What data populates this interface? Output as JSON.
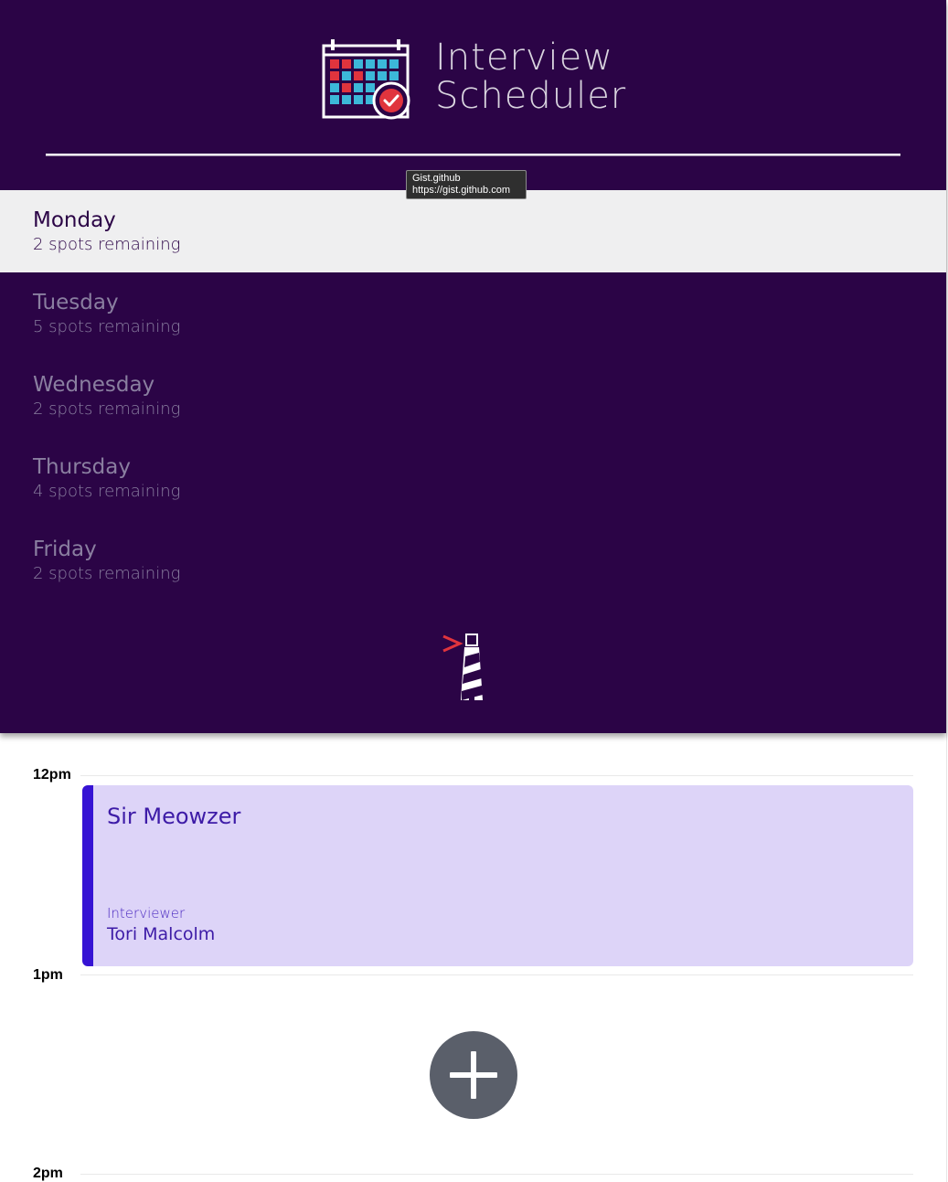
{
  "app": {
    "title_line1": "Interview",
    "title_line2": "Scheduler"
  },
  "tooltip": {
    "title": "Gist.github",
    "url": "https://gist.github.com"
  },
  "days": [
    {
      "name": "Monday",
      "spots": "2 spots remaining",
      "selected": true
    },
    {
      "name": "Tuesday",
      "spots": "5 spots remaining",
      "selected": false
    },
    {
      "name": "Wednesday",
      "spots": "2 spots remaining",
      "selected": false
    },
    {
      "name": "Thursday",
      "spots": "4 spots remaining",
      "selected": false
    },
    {
      "name": "Friday",
      "spots": "2 spots remaining",
      "selected": false
    }
  ],
  "schedule": {
    "times": [
      "12pm",
      "1pm",
      "2pm"
    ],
    "appointment": {
      "student": "Sir Meowzer",
      "interviewer_label": "Interviewer",
      "interviewer": "Tori Malcolm"
    },
    "add_icon": "plus-icon"
  },
  "colors": {
    "sidebar_bg": "#2b0446",
    "selected_day_bg": "#efeff0",
    "appointment_bg": "#ddd4f8",
    "appointment_accent": "#3613d4",
    "add_button": "#5a5f6a"
  }
}
